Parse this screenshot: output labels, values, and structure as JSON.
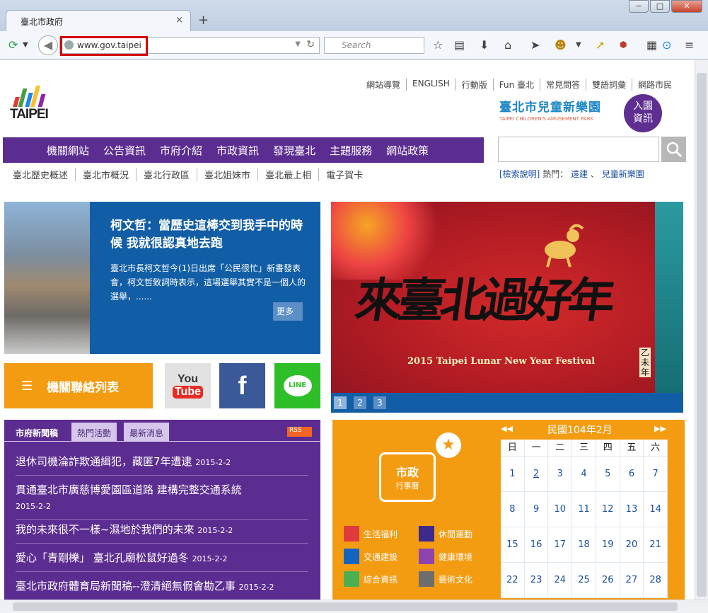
{
  "browser": {
    "tab_title": "臺北市政府",
    "tab_close": "×",
    "new_tab": "+",
    "url": "www.gov.taipei",
    "search_placeholder": "Search",
    "win_min": "−",
    "win_max": "□",
    "win_close": "✕"
  },
  "site": {
    "logo_text": "TAIPEI",
    "top_links": [
      "網站導覽",
      "ENGLISH",
      "行動版",
      "Fun 臺北",
      "常見問答",
      "雙語詞彙",
      "網路市民"
    ],
    "kids_title": "臺北市兒童新樂園",
    "kids_sub": "TAIPEI CHILDREN'S AMUSEMENT PARK",
    "kids_badge_1": "入園",
    "kids_badge_2": "資訊",
    "main_nav": [
      "機關網站",
      "公告資訊",
      "市府介紹",
      "市政資訊",
      "發現臺北",
      "主題服務",
      "網站政策"
    ],
    "sub_nav": [
      "臺北歷史概述",
      "臺北市概況",
      "臺北行政區",
      "臺北姐妹市",
      "臺北最上相",
      "電子賀卡"
    ],
    "hot_help": "[檢索說明]",
    "hot_label": "熱門：",
    "hot_1": "遠建",
    "hot_sep": "、",
    "hot_2": "兒童新樂園"
  },
  "hero": {
    "title": "柯文哲：當歷史這棒交到我手中的時候 我就很認真地去跑",
    "body": "臺北市長柯文哲今(1)日出席「公民很忙」新書發表會，柯文哲致詞時表示，這場選舉其實不是一個人的選舉，......",
    "more": "更多"
  },
  "contacts": {
    "label": "機關聯絡列表",
    "yt_1": "You",
    "yt_2": "Tube",
    "fb": "f",
    "line": "LINE"
  },
  "banner": {
    "big": "來臺北過好年",
    "sub": "2015 Taipei Lunar New Year Festival",
    "side": "乙未年",
    "dots": [
      "1",
      "2",
      "3"
    ]
  },
  "news": {
    "tabs": [
      "市府新聞稿",
      "熱門活動",
      "最新消息"
    ],
    "rss": "RSS",
    "items": [
      {
        "title": "退休司機淪詐欺通緝犯，藏匿7年遭逮",
        "date": "2015-2-2"
      },
      {
        "title": "貫通臺北市廣慈博愛園區道路 建構完整交通系統",
        "date": "2015-2-2"
      },
      {
        "title": "我的未來很不一樣~濕地於我們的未來",
        "date": "2015-2-2"
      },
      {
        "title": "愛心「青剛櫟」 臺北孔廟松鼠好過冬",
        "date": "2015-2-2"
      },
      {
        "title": "臺北市政府體育局新聞稿--澄清絕無假會勘乙事",
        "date": "2015-2-2"
      }
    ]
  },
  "calendar": {
    "prev": "◀◀",
    "month": "民國104年2月",
    "next": "▶▶",
    "weekdays": [
      "日",
      "一",
      "二",
      "三",
      "四",
      "五",
      "六"
    ],
    "rows": [
      [
        "1",
        "2",
        "3",
        "4",
        "5",
        "6",
        "7"
      ],
      [
        "8",
        "9",
        "10",
        "11",
        "12",
        "13",
        "14"
      ],
      [
        "15",
        "16",
        "17",
        "18",
        "19",
        "20",
        "21"
      ],
      [
        "22",
        "23",
        "24",
        "25",
        "26",
        "27",
        "28"
      ]
    ],
    "icon_1": "市政",
    "icon_2": "行事曆",
    "legend": [
      {
        "label": "生活福利",
        "color": "#e03a3e"
      },
      {
        "label": "休閒運動",
        "color": "#3d2a8c"
      },
      {
        "label": "交通建設",
        "color": "#1565c0"
      },
      {
        "label": "健康環境",
        "color": "#8e44ad"
      },
      {
        "label": "綜合資訊",
        "color": "#4caf50"
      },
      {
        "label": "藝術文化",
        "color": "#6d6d6d"
      }
    ]
  },
  "colors": {
    "nav_purple": "#5c2d91",
    "hero_blue": "#125ea6",
    "orange": "#f39c12"
  }
}
